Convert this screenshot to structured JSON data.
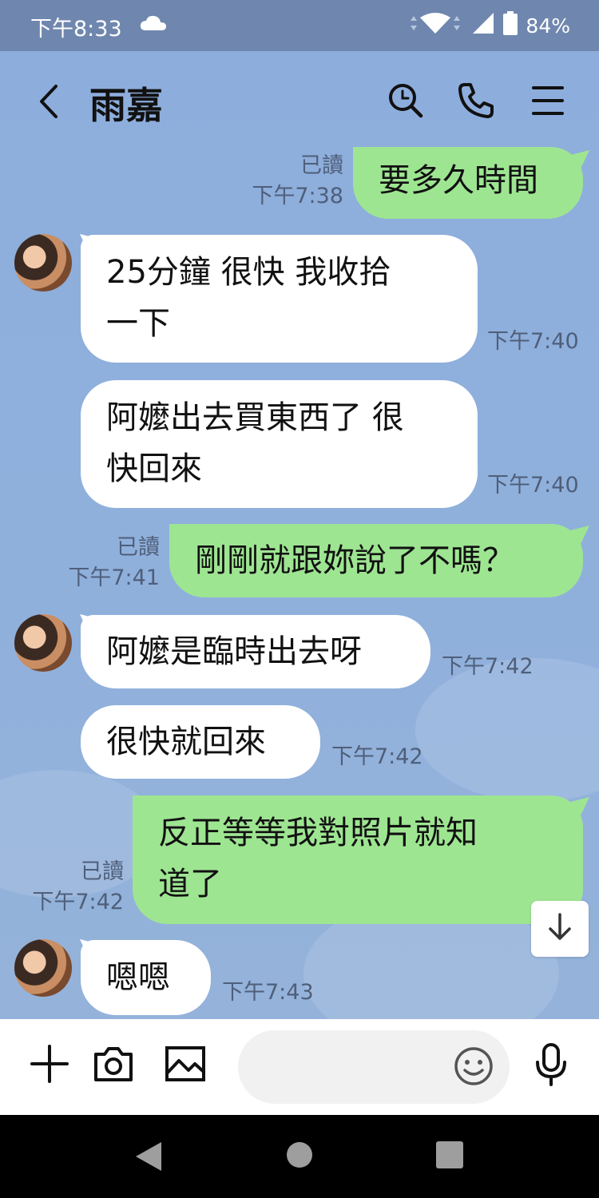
{
  "status_bar": {
    "time": "下午8:33",
    "battery": "84%",
    "icons": [
      "cloud-icon",
      "wifi-icon",
      "signal-icon",
      "battery-icon"
    ]
  },
  "header": {
    "title": "雨嘉",
    "icons": [
      "back-chevron-icon",
      "search-icon",
      "phone-icon",
      "menu-icon"
    ]
  },
  "messages": [
    {
      "side": "out",
      "text": "要多久時間",
      "read": "已讀",
      "time": "下午7:38"
    },
    {
      "side": "in",
      "lines": [
        "25分鐘  很快  我收拾",
        "一下"
      ],
      "time": "下午7:40"
    },
    {
      "side": "in",
      "lines": [
        "阿嬤出去買東西了  很",
        "快回來"
      ],
      "time": "下午7:40"
    },
    {
      "side": "out",
      "text": "剛剛就跟妳說了不嗎？",
      "read": "已讀",
      "time": "下午7:41"
    },
    {
      "side": "in",
      "text": "阿嬤是臨時出去呀",
      "time": "下午7:42"
    },
    {
      "side": "in",
      "text": "很快就回來",
      "time": "下午7:42"
    },
    {
      "side": "out",
      "lines": [
        "反正等等我對照片就知",
        "道了"
      ],
      "read": "已讀",
      "time": "下午7:42"
    },
    {
      "side": "in",
      "text": "嗯嗯",
      "time": "下午7:43"
    }
  ],
  "input_bar": {
    "placeholder": "",
    "icons": [
      "plus-icon",
      "camera-icon",
      "image-icon",
      "emoji-icon",
      "microphone-icon"
    ]
  },
  "colors": {
    "chat_background": "#8eaedb",
    "outgoing_bubble": "#9ee592",
    "incoming_bubble": "#ffffff",
    "status_bar": "#6f87ae"
  }
}
